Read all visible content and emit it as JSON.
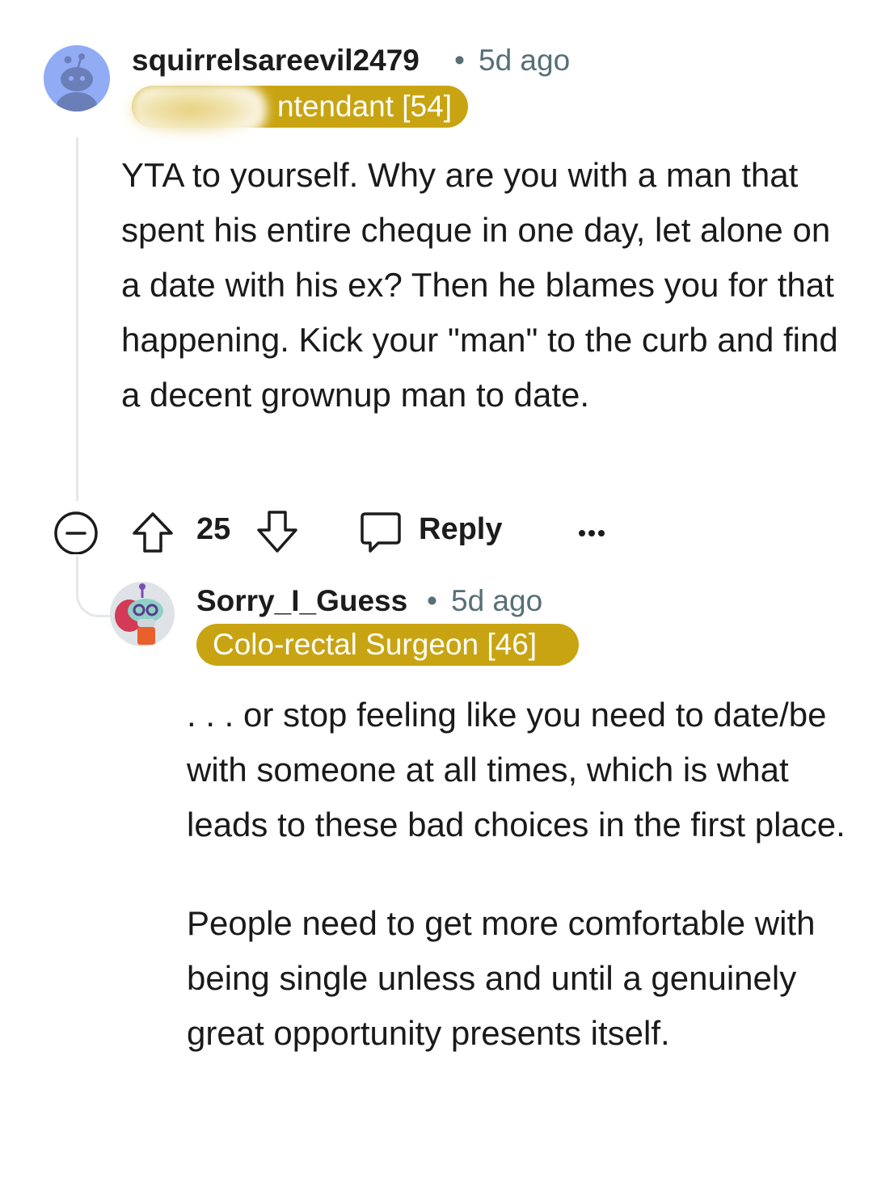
{
  "comments": [
    {
      "username": "squirrelsareevil2479",
      "time": "5d ago",
      "separator": "•",
      "flair": "Gentle Attendant [54]",
      "flair_visible": "ntendant [54]",
      "flair_color": "#c9a412",
      "avatar": "snoo-avatar",
      "body": [
        "YTA to yourself. Why are you with a man that spent his entire cheque in one day, let alone on a date with his ex? Then he blames you for that happening. Kick your \"man\" to the curb and find a decent grownup man to date."
      ],
      "actions": {
        "collapse_icon": "collapse-icon",
        "upvote_icon": "upvote-arrow-icon",
        "score": "25",
        "downvote_icon": "downvote-arrow-icon",
        "reply_icon": "speech-bubble-icon",
        "reply_label": "Reply",
        "more_icon": "more-dots-icon"
      }
    },
    {
      "username": "Sorry_I_Guess",
      "time": "5d ago",
      "separator": "•",
      "flair": "Colo-rectal Surgeon [46]",
      "flair_color": "#c9a412",
      "avatar": "custom-snoo-avatar",
      "body": [
        ". . . or stop feeling like you need to date/be with someone at all times, which is what leads to these bad choices in the first place.",
        "People need to get more comfortable with being single unless and until a genuinely great opportunity presents itself."
      ]
    }
  ],
  "colors": {
    "meta_text": "#576f76",
    "thread_line": "#e5e7e9",
    "avatar1_bg": "#91acf5"
  }
}
